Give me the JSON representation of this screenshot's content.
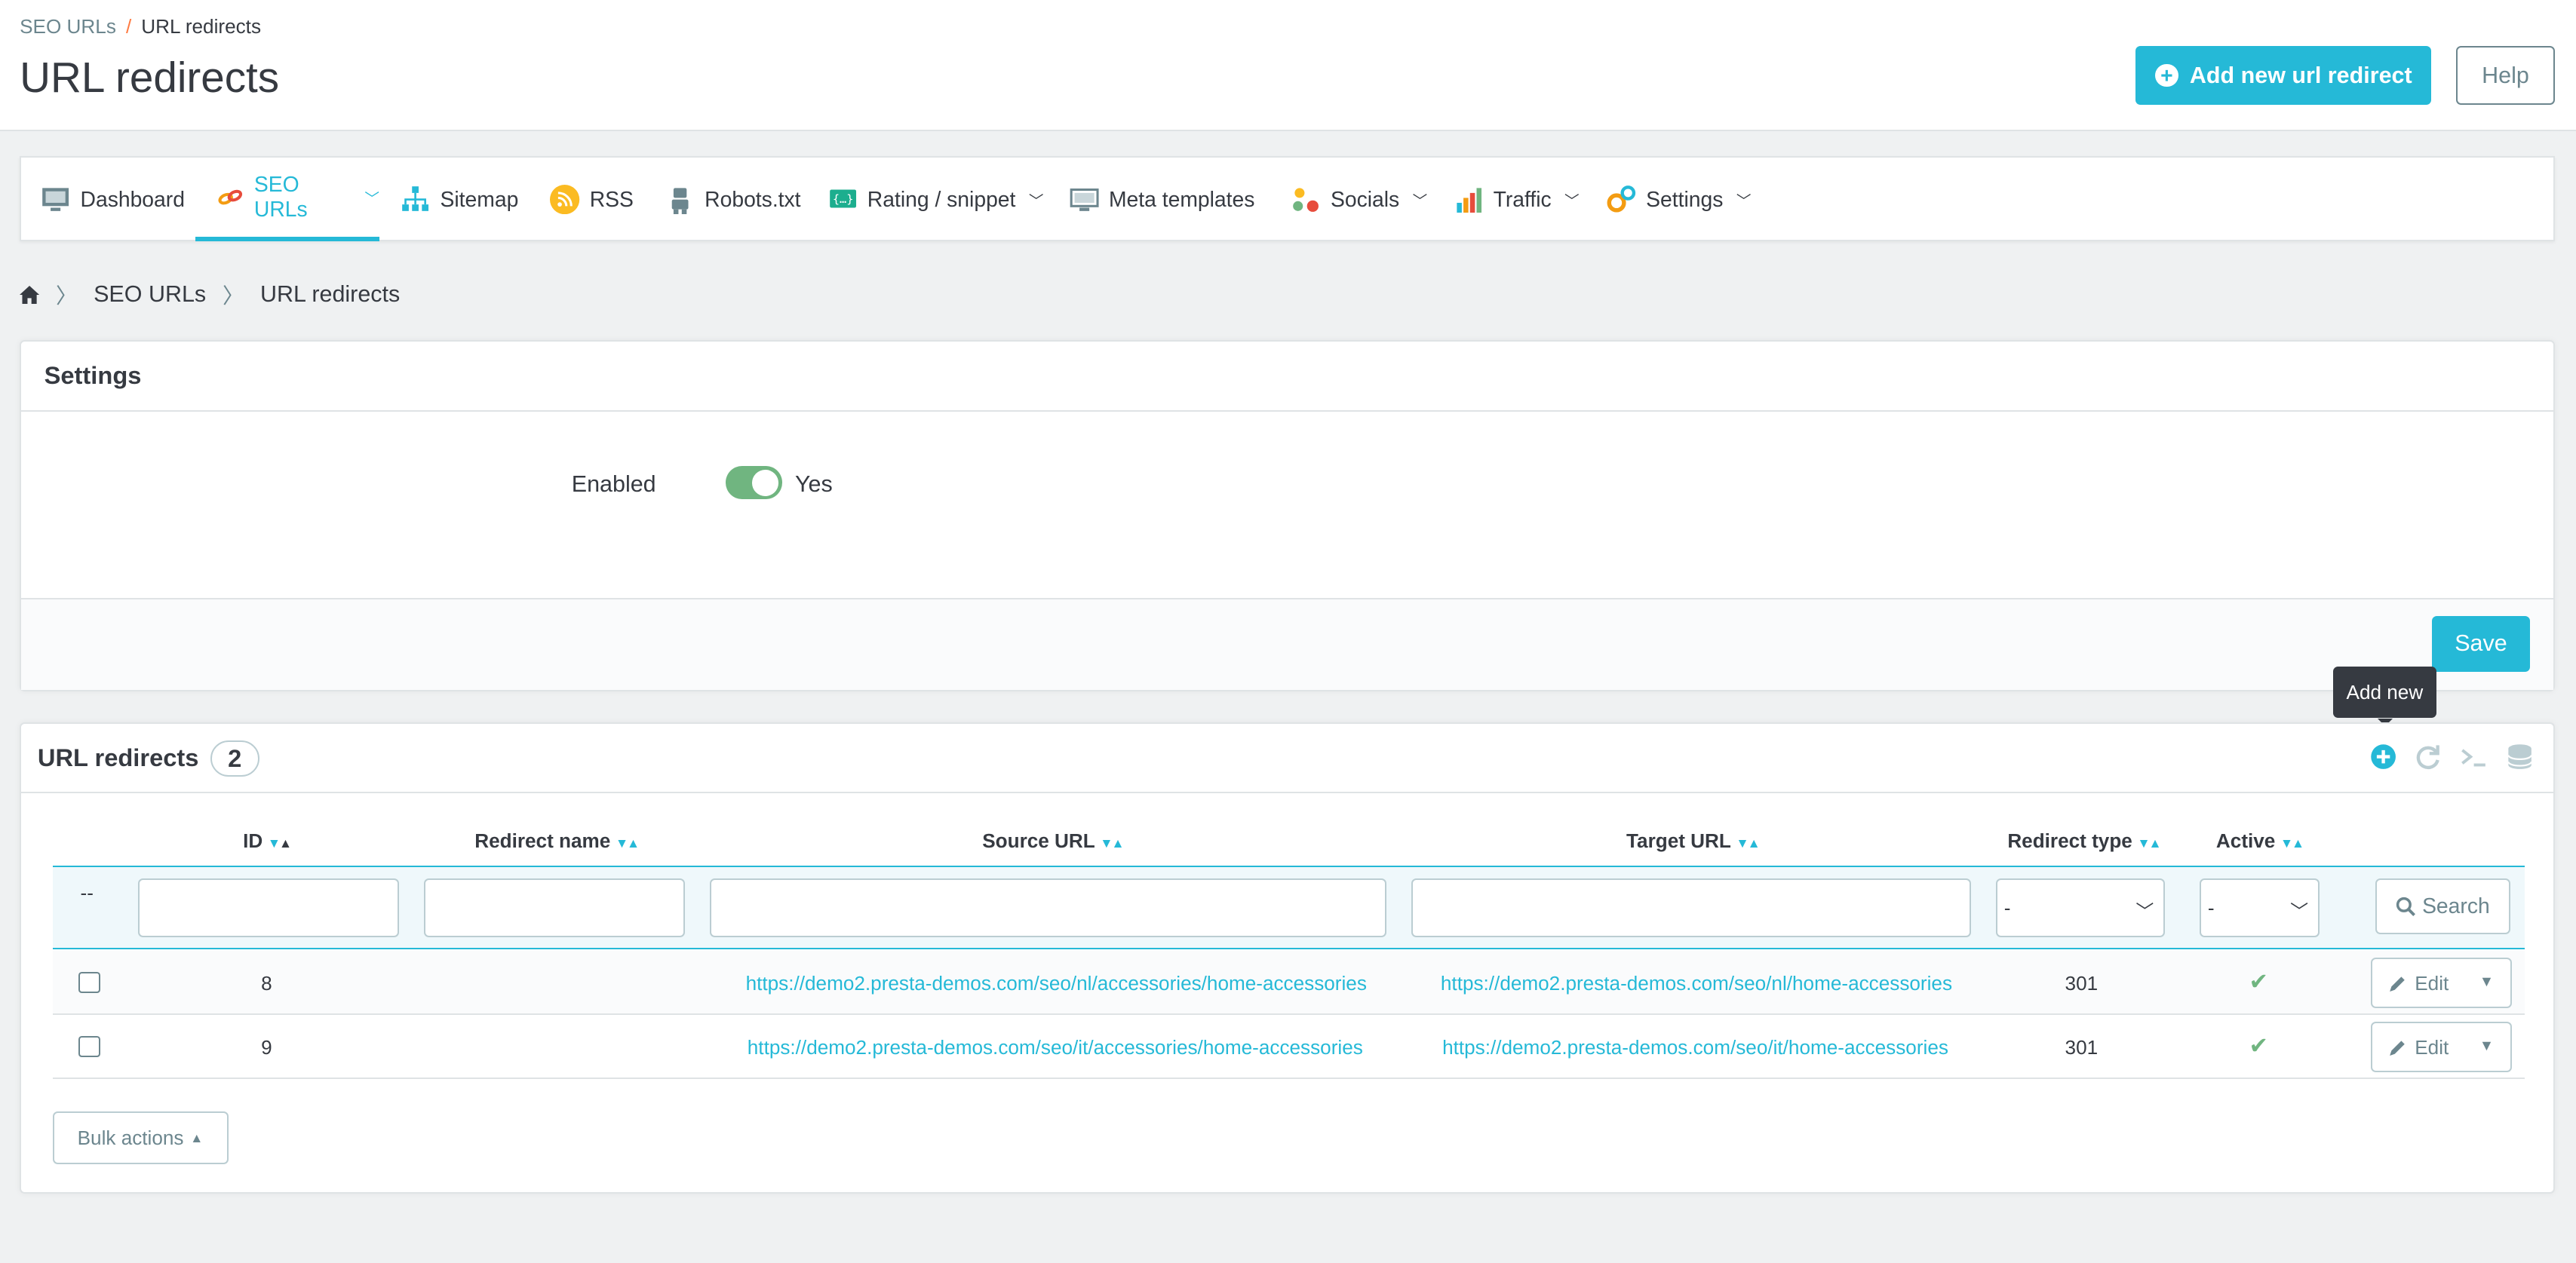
{
  "header": {
    "breadcrumb": [
      "SEO URLs",
      "URL redirects"
    ],
    "breadcrumb_sep": "/",
    "title": "URL redirects",
    "add_button": "Add new url redirect",
    "help_button": "Help"
  },
  "tabs": [
    {
      "label": "Dashboard",
      "icon": "monitor-icon"
    },
    {
      "label": "SEO URLs",
      "icon": "link-icon",
      "active": true,
      "dropdown": true
    },
    {
      "label": "Sitemap",
      "icon": "sitemap-icon"
    },
    {
      "label": "RSS",
      "icon": "rss-icon"
    },
    {
      "label": "Robots.txt",
      "icon": "robot-icon"
    },
    {
      "label": "Rating / snippet",
      "icon": "code-icon",
      "dropdown": true
    },
    {
      "label": "Meta templates",
      "icon": "screen-icon"
    },
    {
      "label": "Socials",
      "icon": "share-icon",
      "dropdown": true
    },
    {
      "label": "Traffic",
      "icon": "chart-icon",
      "dropdown": true
    },
    {
      "label": "Settings",
      "icon": "gears-icon",
      "dropdown": true
    }
  ],
  "breadcrumb_nav": {
    "home_icon": "home-icon",
    "items": [
      "SEO URLs",
      "URL redirects"
    ]
  },
  "settings": {
    "title": "Settings",
    "enabled_label": "Enabled",
    "enabled_value": "Yes",
    "save_button": "Save"
  },
  "tooltip": "Add new",
  "list": {
    "title": "URL redirects",
    "count": "2",
    "columns": [
      "ID",
      "Redirect name",
      "Source URL",
      "Target URL",
      "Redirect type",
      "Active"
    ],
    "filter_placeholder_dash": "--",
    "filter_select_value": "-",
    "search_button": "Search",
    "rows": [
      {
        "id": "8",
        "name": "",
        "source": "https://demo2.presta-demos.com/seo/nl/accessories/home-accessories",
        "target": "https://demo2.presta-demos.com/seo/nl/home-accessories",
        "type": "301",
        "active": "✔",
        "edit": "Edit"
      },
      {
        "id": "9",
        "name": "",
        "source": "https://demo2.presta-demos.com/seo/it/accessories/home-accessories",
        "target": "https://demo2.presta-demos.com/seo/it/home-accessories",
        "type": "301",
        "active": "✔",
        "edit": "Edit"
      }
    ],
    "bulk_button": "Bulk actions"
  },
  "colors": {
    "accent": "#25b9d7",
    "success": "#70b580",
    "text": "#363a41"
  }
}
